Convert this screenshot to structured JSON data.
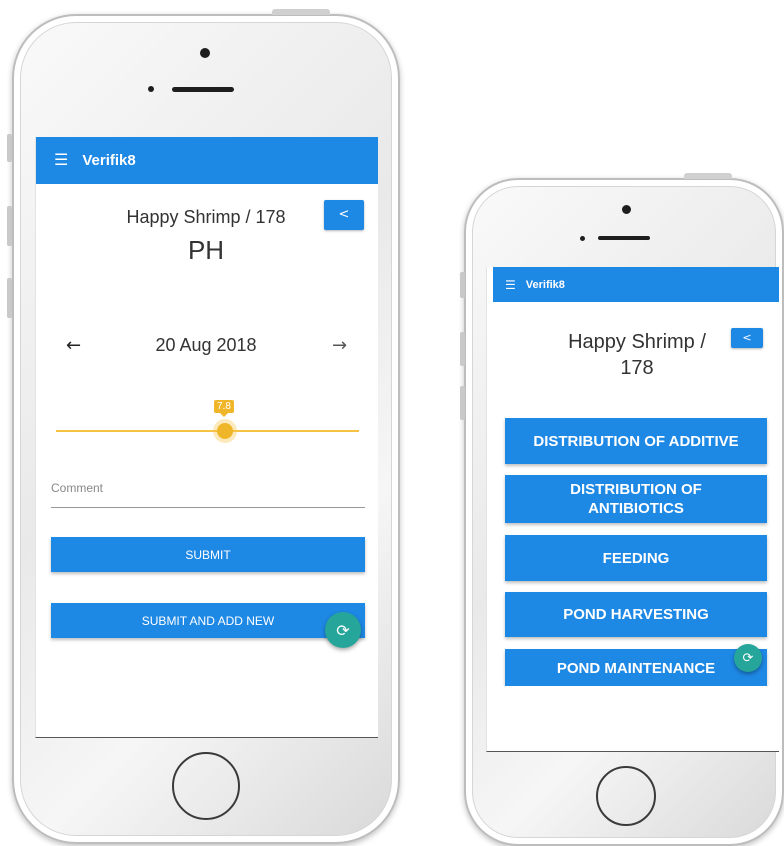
{
  "left_phone": {
    "app_bar": {
      "menu_icon": "hamburger-menu-icon",
      "title": "Verifik8"
    },
    "header": {
      "pond_title": "Happy Shrimp / 178",
      "back_label": "<",
      "parameter": "PH"
    },
    "date_nav": {
      "prev_arrow": "←",
      "date": "20 Aug 2018",
      "next_arrow": "→"
    },
    "slider": {
      "value_label": "7.8",
      "value": 7.8,
      "min": 0,
      "max": 14,
      "color": "#f0b62a"
    },
    "comment": {
      "placeholder": "Comment"
    },
    "buttons": {
      "submit": "SUBMIT",
      "submit_and_add_new": "SUBMIT AND ADD NEW"
    },
    "fab_icon": "sync-icon"
  },
  "right_phone": {
    "app_bar": {
      "menu_icon": "hamburger-menu-icon",
      "title": "Verifik8"
    },
    "header": {
      "pond_title": "Happy Shrimp / 178",
      "back_label": "<"
    },
    "activities": [
      {
        "label": "DISTRIBUTION OF ADDITIVE"
      },
      {
        "label": "DISTRIBUTION OF ANTIBIOTICS"
      },
      {
        "label": "FEEDING"
      },
      {
        "label": "POND HARVESTING"
      },
      {
        "label": "POND MAINTENANCE"
      }
    ],
    "fab_icon": "sync-icon"
  },
  "colors": {
    "primary": "#1e88e5",
    "fab": "#26a69a",
    "slider": "#f0b62a"
  }
}
